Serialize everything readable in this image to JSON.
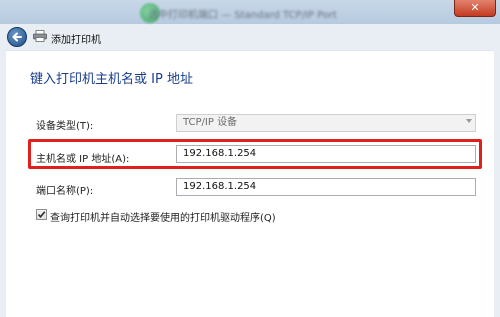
{
  "window": {
    "title": "选中打印机端口 — Standard TCP/IP Port",
    "close_label": "✕"
  },
  "nav": {
    "title": "添加打印机"
  },
  "page": {
    "heading": "键入打印机主机名或 IP 地址"
  },
  "form": {
    "device_type": {
      "label": "设备类型(T):",
      "value": "TCP/IP 设备"
    },
    "host": {
      "label": "主机名或 IP 地址(A):",
      "value": "192.168.1.254"
    },
    "port": {
      "label": "端口名称(P):",
      "value": "192.168.1.254"
    },
    "query": {
      "label": "查询打印机并自动选择要使用的打印机驱动程序(Q)",
      "checked": true
    }
  },
  "colors": {
    "highlight": "#e0201b",
    "heading": "#1a3e8c"
  }
}
